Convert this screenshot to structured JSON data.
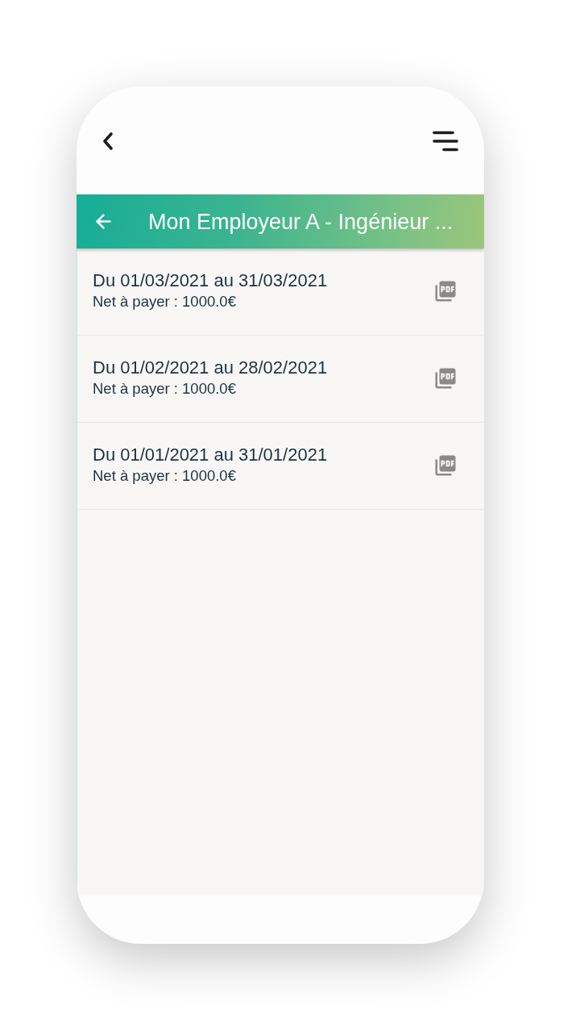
{
  "header": {
    "title": "Mon Employeur A - Ingénieur ..."
  },
  "payslips": [
    {
      "period": "Du 01/03/2021 au 31/03/2021",
      "net": "Net à payer : 1000.0€"
    },
    {
      "period": "Du 01/02/2021 au 28/02/2021",
      "net": "Net à payer : 1000.0€"
    },
    {
      "period": "Du 01/01/2021 au 31/01/2021",
      "net": "Net à payer : 1000.0€"
    }
  ]
}
